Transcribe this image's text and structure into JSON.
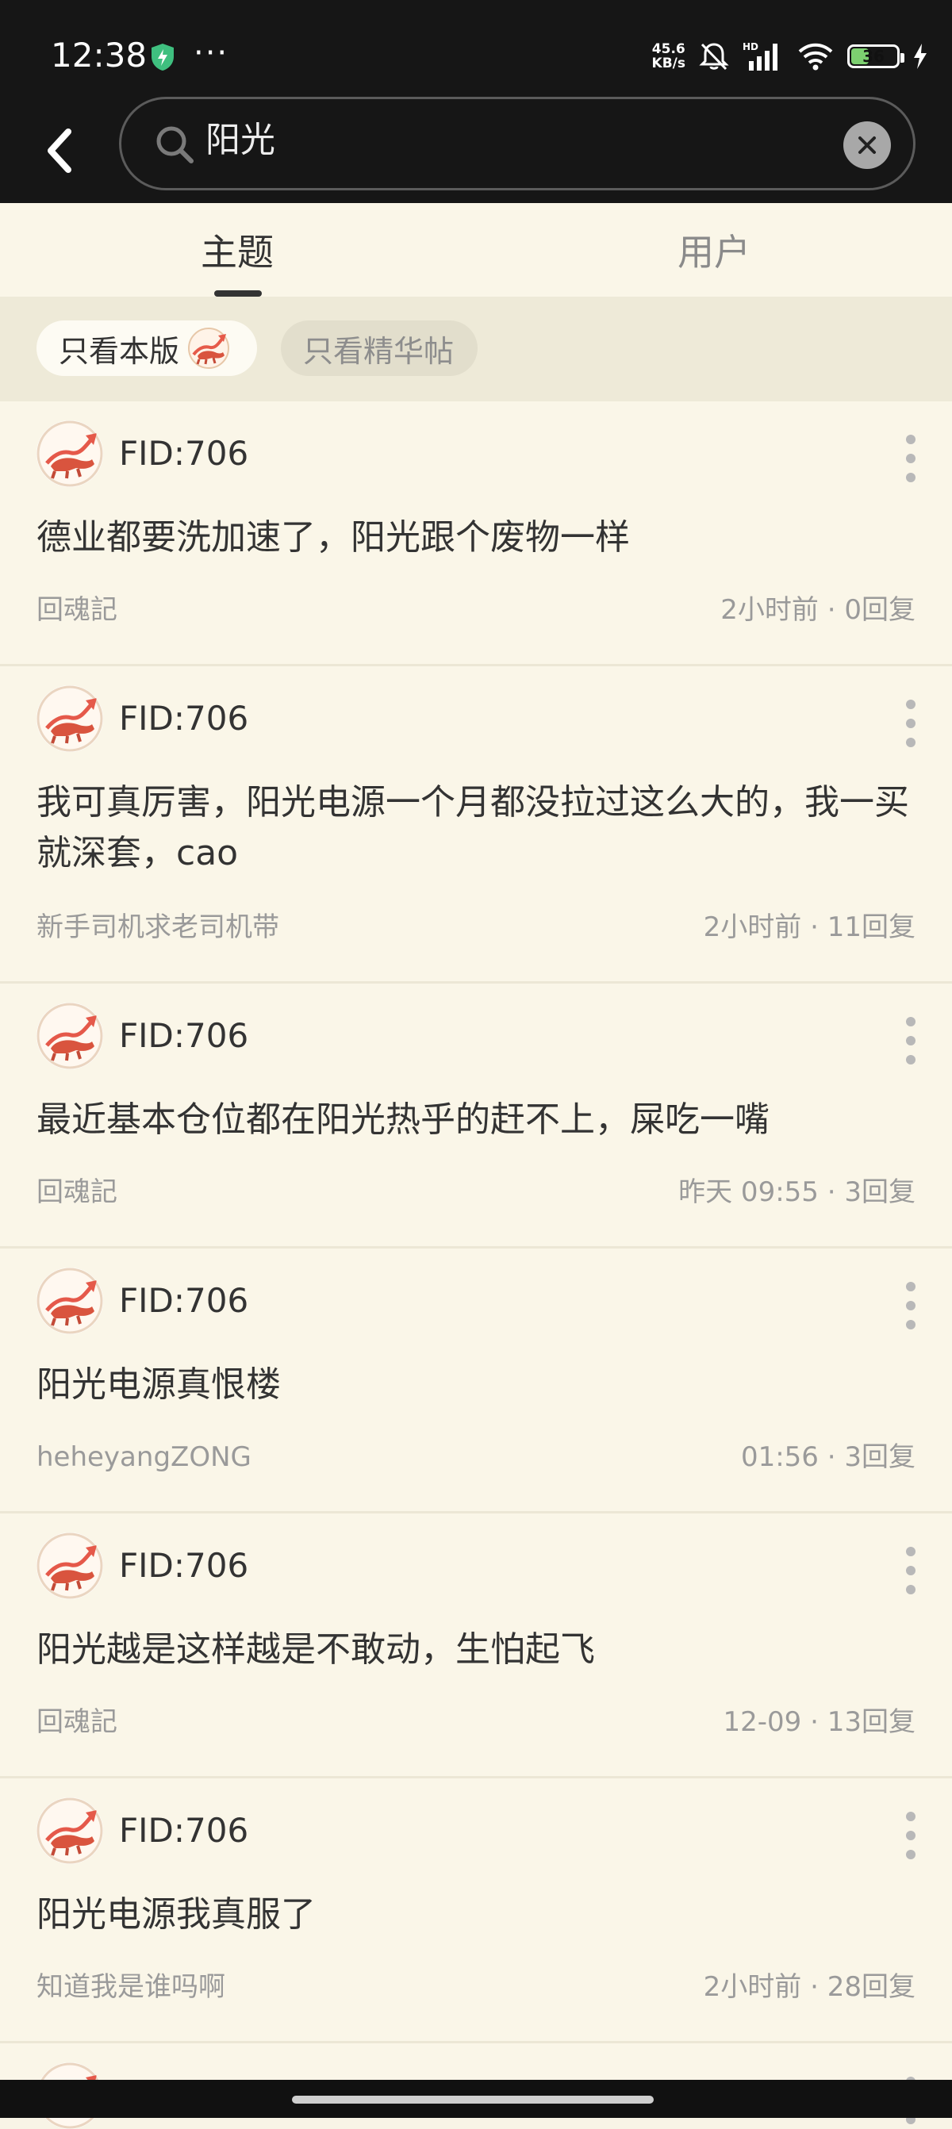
{
  "status_bar": {
    "time": "12:38",
    "more": "···",
    "speed_top": "45.6",
    "speed_bottom": "KB/s",
    "battery": "36",
    "icons": [
      "shield-icon",
      "bell-off-icon",
      "hd-signal-icon",
      "wifi-icon",
      "battery-icon",
      "charging-icon"
    ]
  },
  "search": {
    "query": "阳光",
    "back_icon": "chevron-left-icon",
    "search_icon": "search-icon",
    "clear_icon": "close-icon"
  },
  "tabs": [
    {
      "label": "主题",
      "active": true
    },
    {
      "label": "用户",
      "active": false
    }
  ],
  "filters": {
    "board_only": "只看本版",
    "essence_only": "只看精华帖"
  },
  "posts": [
    {
      "author": "FID:706",
      "title": "德业都要洗加速了，阳光跟个废物一样",
      "board": "回魂記",
      "time": "2小时前",
      "replies": "0回复"
    },
    {
      "author": "FID:706",
      "title": "我可真厉害，阳光电源一个月都没拉过这么大的，我一买就深套，cao",
      "board": "新手司机求老司机带",
      "time": "2小时前",
      "replies": "11回复"
    },
    {
      "author": "FID:706",
      "title": "最近基本仓位都在阳光热乎的赶不上，屎吃一嘴",
      "board": "回魂記",
      "time": "昨天  09:55",
      "replies": "3回复"
    },
    {
      "author": "FID:706",
      "title": "阳光电源真恨楼",
      "board": "heheyangZONG",
      "time": "01:56",
      "replies": "3回复"
    },
    {
      "author": "FID:706",
      "title": "阳光越是这样越是不敢动，生怕起飞",
      "board": "回魂記",
      "time": "12-09",
      "replies": "13回复"
    },
    {
      "author": "FID:706",
      "title": "阳光电源我真服了",
      "board": "知道我是谁吗啊",
      "time": "2小时前",
      "replies": "28回复"
    }
  ],
  "colors": {
    "background": "#f8f4e6",
    "header": "#161616",
    "text": "#333333",
    "secondary_text": "#9a9a9a"
  }
}
